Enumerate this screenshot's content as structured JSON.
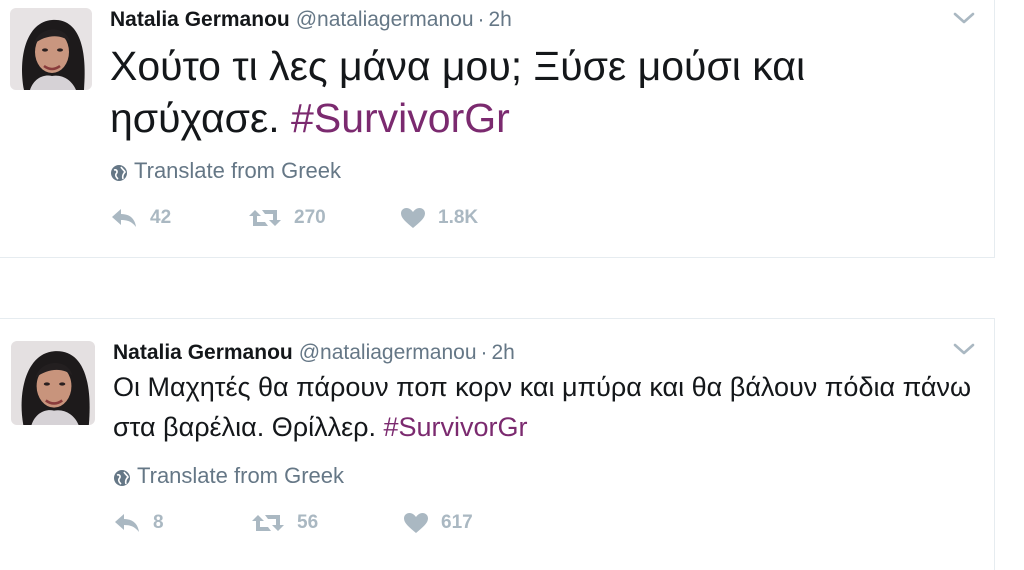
{
  "tweets": [
    {
      "name": "Natalia Germanou",
      "handle": "@nataliagermanou",
      "separator": "·",
      "time": "2h",
      "text": "Χούτο τι λες μάνα μου; Ξύσε μούσι και ησύχασε.",
      "hashtag": "#SurvivorGr",
      "translate": "Translate from Greek",
      "replies": "42",
      "retweets": "270",
      "likes": "1.8K"
    },
    {
      "name": "Natalia Germanou",
      "handle": "@nataliagermanou",
      "separator": "·",
      "time": "2h",
      "text": "Οι Μαχητές θα πάρουν ποπ κορν και μπύρα και θα βάλουν πόδια πάνω στα βαρέλια. Θρίλλερ.",
      "hashtag": "#SurvivorGr",
      "translate": "Translate from Greek",
      "replies": "8",
      "retweets": "56",
      "likes": "617"
    }
  ],
  "colors": {
    "hashtag": "#7b2a6f",
    "muted": "#657786",
    "action": "#aab8c2",
    "text": "#14171a"
  },
  "icons": [
    "chevron-down-icon",
    "globe-icon",
    "reply-icon",
    "retweet-icon",
    "heart-icon"
  ]
}
